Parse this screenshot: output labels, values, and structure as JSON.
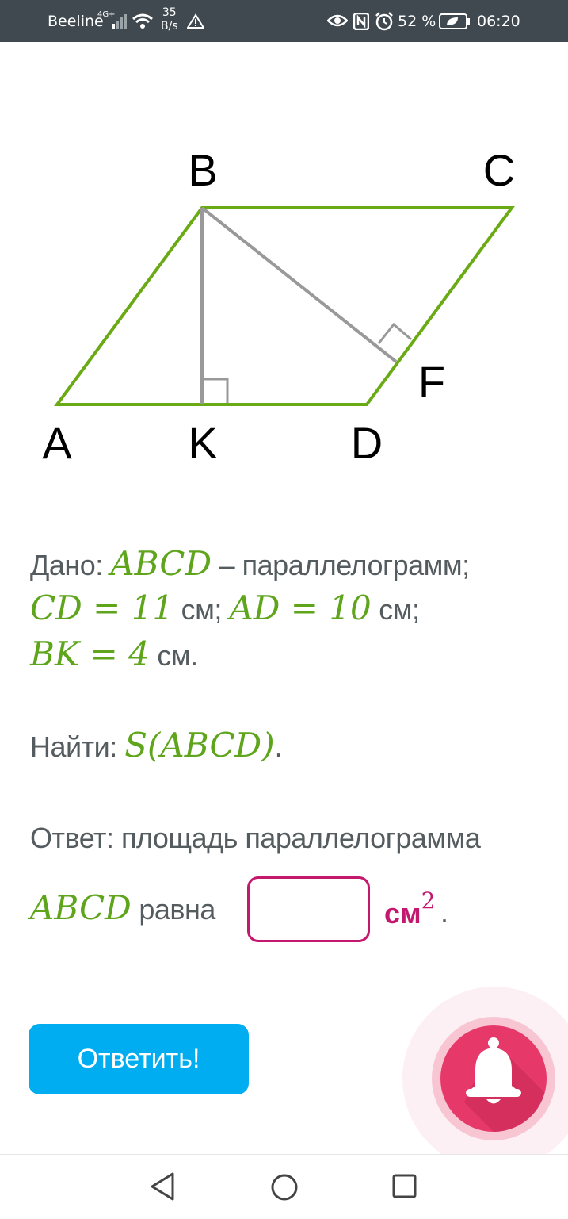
{
  "status_bar": {
    "carrier": "Beeline",
    "network": "4G+",
    "speed_value": "35",
    "speed_unit": "B/s",
    "battery": "52 %",
    "time": "06:20"
  },
  "figure": {
    "labels": {
      "A": "A",
      "B": "B",
      "C": "C",
      "D": "D",
      "K": "K",
      "F": "F"
    },
    "colors": {
      "parallelogram": "#6aaa14",
      "heights": "#999999"
    }
  },
  "problem": {
    "given_label": "Дано:",
    "given_figure": "ABCD",
    "given_dash_text": " – параллелограмм;",
    "cd_expr": "CD = 11",
    "cd_unit": " см;",
    "ad_expr": "AD = 10",
    "ad_unit": " см;",
    "bk_expr": "BK = 4",
    "bk_unit": " см.",
    "find_label": "Найти:",
    "find_expr": "S(ABCD)",
    "find_end": ".",
    "answer_text": "Ответ: площадь параллелограмма",
    "answer_figure": "ABCD",
    "answer_word": "равна",
    "answer_value": "",
    "unit": "см",
    "unit_power": "2",
    "answer_end": "."
  },
  "submit_label": "Ответить!",
  "colors": {
    "accent_math": "#5ea51c",
    "answer_border": "#c4186f",
    "button": "#00adf0",
    "bell": "#e6396a"
  }
}
